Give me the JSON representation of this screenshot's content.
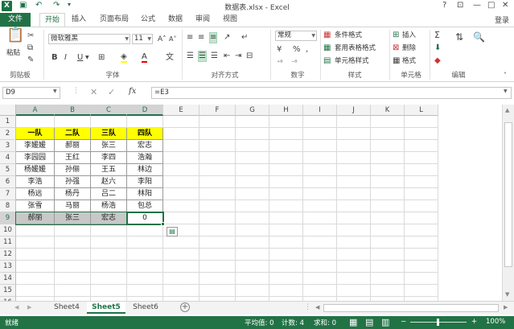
{
  "titlebar": {
    "app_icon": "X",
    "title": "数据表.xlsx - Excel",
    "help": "?",
    "restore_ribbon": "⊡",
    "minimize": "—",
    "maximize": "□",
    "close": "✕"
  },
  "tabs": [
    "文件",
    "开始",
    "插入",
    "页面布局",
    "公式",
    "数据",
    "审阅",
    "视图"
  ],
  "login": "登录",
  "ribbon": {
    "clipboard": {
      "paste": "粘贴",
      "label": "剪贴板"
    },
    "font": {
      "name": "微软雅黑",
      "size": "11",
      "bold": "B",
      "italic": "I",
      "underline": "U",
      "label": "字体"
    },
    "alignment": {
      "label": "对齐方式"
    },
    "number": {
      "format": "常规",
      "percent": "%",
      "comma": ",",
      "label": "数字"
    },
    "styles": {
      "conditional": "条件格式",
      "table": "套用表格格式",
      "cell": "单元格样式",
      "label": "样式"
    },
    "cells": {
      "insert": "插入",
      "delete": "删除",
      "format": "格式",
      "label": "单元格"
    },
    "editing": {
      "sum": "Σ",
      "label": "编辑"
    }
  },
  "formula_bar": {
    "name_box": "D9",
    "fx": "fx",
    "formula": "=E3"
  },
  "grid": {
    "columns": [
      "A",
      "B",
      "C",
      "D",
      "E",
      "F",
      "G",
      "H",
      "I",
      "J",
      "K",
      "L"
    ],
    "rows": [
      "1",
      "2",
      "3",
      "4",
      "5",
      "6",
      "7",
      "8",
      "9",
      "10",
      "11",
      "12",
      "13",
      "14",
      "15",
      "16"
    ],
    "header": [
      "一队",
      "二队",
      "三队",
      "四队"
    ],
    "data": [
      [
        "李媛媛",
        "郝丽",
        "张三",
        "宏志"
      ],
      [
        "李园园",
        "王红",
        "李四",
        "浩瀚"
      ],
      [
        "杨媛媛",
        "孙俪",
        "王五",
        "林边"
      ],
      [
        "李浩",
        "孙强",
        "赵六",
        "李阳"
      ],
      [
        "杨远",
        "杨丹",
        "吕二",
        "林阳"
      ],
      [
        "张雪",
        "马丽",
        "杨浩",
        "包总"
      ],
      [
        "郝丽",
        "张三",
        "宏志",
        "0"
      ]
    ]
  },
  "sheets": [
    "Sheet4",
    "Sheet5",
    "Sheet6"
  ],
  "active_sheet": "Sheet5",
  "status": {
    "ready": "就绪",
    "average": "平均值: 0",
    "count": "计数: 4",
    "sum": "求和: 0",
    "zoom": "100%"
  },
  "colors": {
    "accent": "#217346",
    "header_fill": "#ffff00",
    "selection": "#c8c8c8"
  }
}
